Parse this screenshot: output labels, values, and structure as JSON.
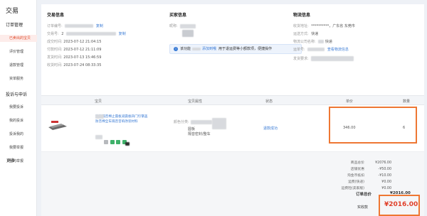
{
  "sidebar": {
    "title": "交易",
    "groups": [
      {
        "label": "订单管理",
        "items": [
          "已卖出的宝贝",
          "评价管理",
          "退款管理",
          "资单服务"
        ]
      },
      {
        "label": "投诉与申诉",
        "items": [
          "我要投诉",
          "我的投诉",
          "投诉我的",
          "我要举报",
          "我的举报"
        ]
      },
      {
        "label": "更多",
        "items": []
      }
    ],
    "active_item": "已卖出的宝贝"
  },
  "trade_info": {
    "title": "交易信息",
    "rows": [
      {
        "key": "订单编号:",
        "value": "",
        "extra": "复制"
      },
      {
        "key": "交易号:",
        "value": "2",
        "extra": "复制"
      },
      {
        "key": "成交时间:",
        "value": "2023-07-12 21:04:15"
      },
      {
        "key": "付款时间:",
        "value": "2023-07-12 21:11:09"
      },
      {
        "key": "发货时间:",
        "value": "2023-07-13 15:46:59"
      },
      {
        "key": "收货时间:",
        "value": "2023-07-24 08:33:35"
      }
    ]
  },
  "buyer_info": {
    "title": "买家信息",
    "nickname_key": "昵称:",
    "notice_prefix": "该功能",
    "notice_link": "添加到哦",
    "notice_text": "用于退运费等小额款项，便捷操作"
  },
  "logistics_info": {
    "title": "物流信息",
    "rows": [
      {
        "key": "收货地址:",
        "value": "**********，广东省 东莞市"
      },
      {
        "key": "运送方式:",
        "value": "快递"
      },
      {
        "key": "物流公司名称:",
        "value": "快递"
      },
      {
        "key": "运单号:",
        "value": "",
        "extra": "查看物流信息"
      },
      {
        "key": "发货要求:",
        "value": ""
      }
    ]
  },
  "table": {
    "headers": [
      "宝贝",
      "宝贝属性",
      "状态",
      "单价",
      "数量"
    ],
    "row": {
      "title": "汽车隔音棉止震板减震板四门引擎盖防音棉全车隔音音响改装材料",
      "attr_key": "颜色分类:",
      "attr_lines": [
        "圆板",
        "隔音密封/整车"
      ],
      "status": "退款成功",
      "price": "346.00",
      "qty": "6"
    }
  },
  "summary": {
    "rows": [
      {
        "key": "商品总价",
        "value": "¥2076.00"
      },
      {
        "key": "店铺优惠",
        "value": "-¥50.00"
      },
      {
        "key": "淘金币抵扣",
        "value": "-¥10.00"
      },
      {
        "key": "运费(快递)",
        "value": "¥0.00"
      },
      {
        "key": "运费险(卖家版)",
        "value": "¥0.00"
      }
    ],
    "order_total_label": "订单总价",
    "order_total_value": "¥2016.00",
    "paid_label": "实收款",
    "paid_value": "¥2016.00"
  },
  "colors": {
    "accent": "#e04a2a",
    "link": "#3a7bd5",
    "highlight": "#ee7733"
  }
}
